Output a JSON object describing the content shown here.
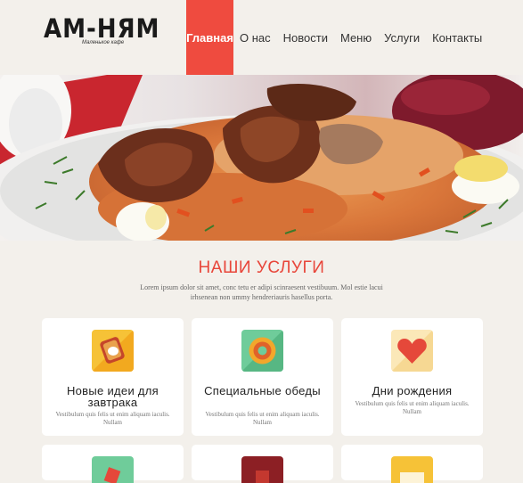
{
  "logo": {
    "title": "АМ-НЯМ",
    "subtitle": "Маленькое кафе"
  },
  "nav": [
    "Главная",
    "О нас",
    "Новости",
    "Меню",
    "Услуги",
    "Контакты"
  ],
  "services": {
    "title": "НАШИ УСЛУГИ",
    "intro": "Lorem ipsum dolor sit amet, conc tetu er adipi scinraesent vestibuum. Mol estie lacui irhsenean non ummy hendreriauris hasellus porta.",
    "cards": [
      {
        "title": "Новые идеи для завтрака",
        "text": "Vestibulum quis felis ut enim aliquam iaculis. Nullam",
        "icon": "breakfast-icon"
      },
      {
        "title": "Специальные обеды",
        "text": "Vestibulum quis felis ut enim aliquam iaculis. Nullam",
        "icon": "lunch-icon"
      },
      {
        "title": "Дни рождения",
        "text": "Vestibulum quis felis ut enim aliquam iaculis. Nullam",
        "icon": "heart-icon"
      }
    ]
  },
  "colors": {
    "accent": "#ef4b3f",
    "background": "#f3f0eb"
  }
}
